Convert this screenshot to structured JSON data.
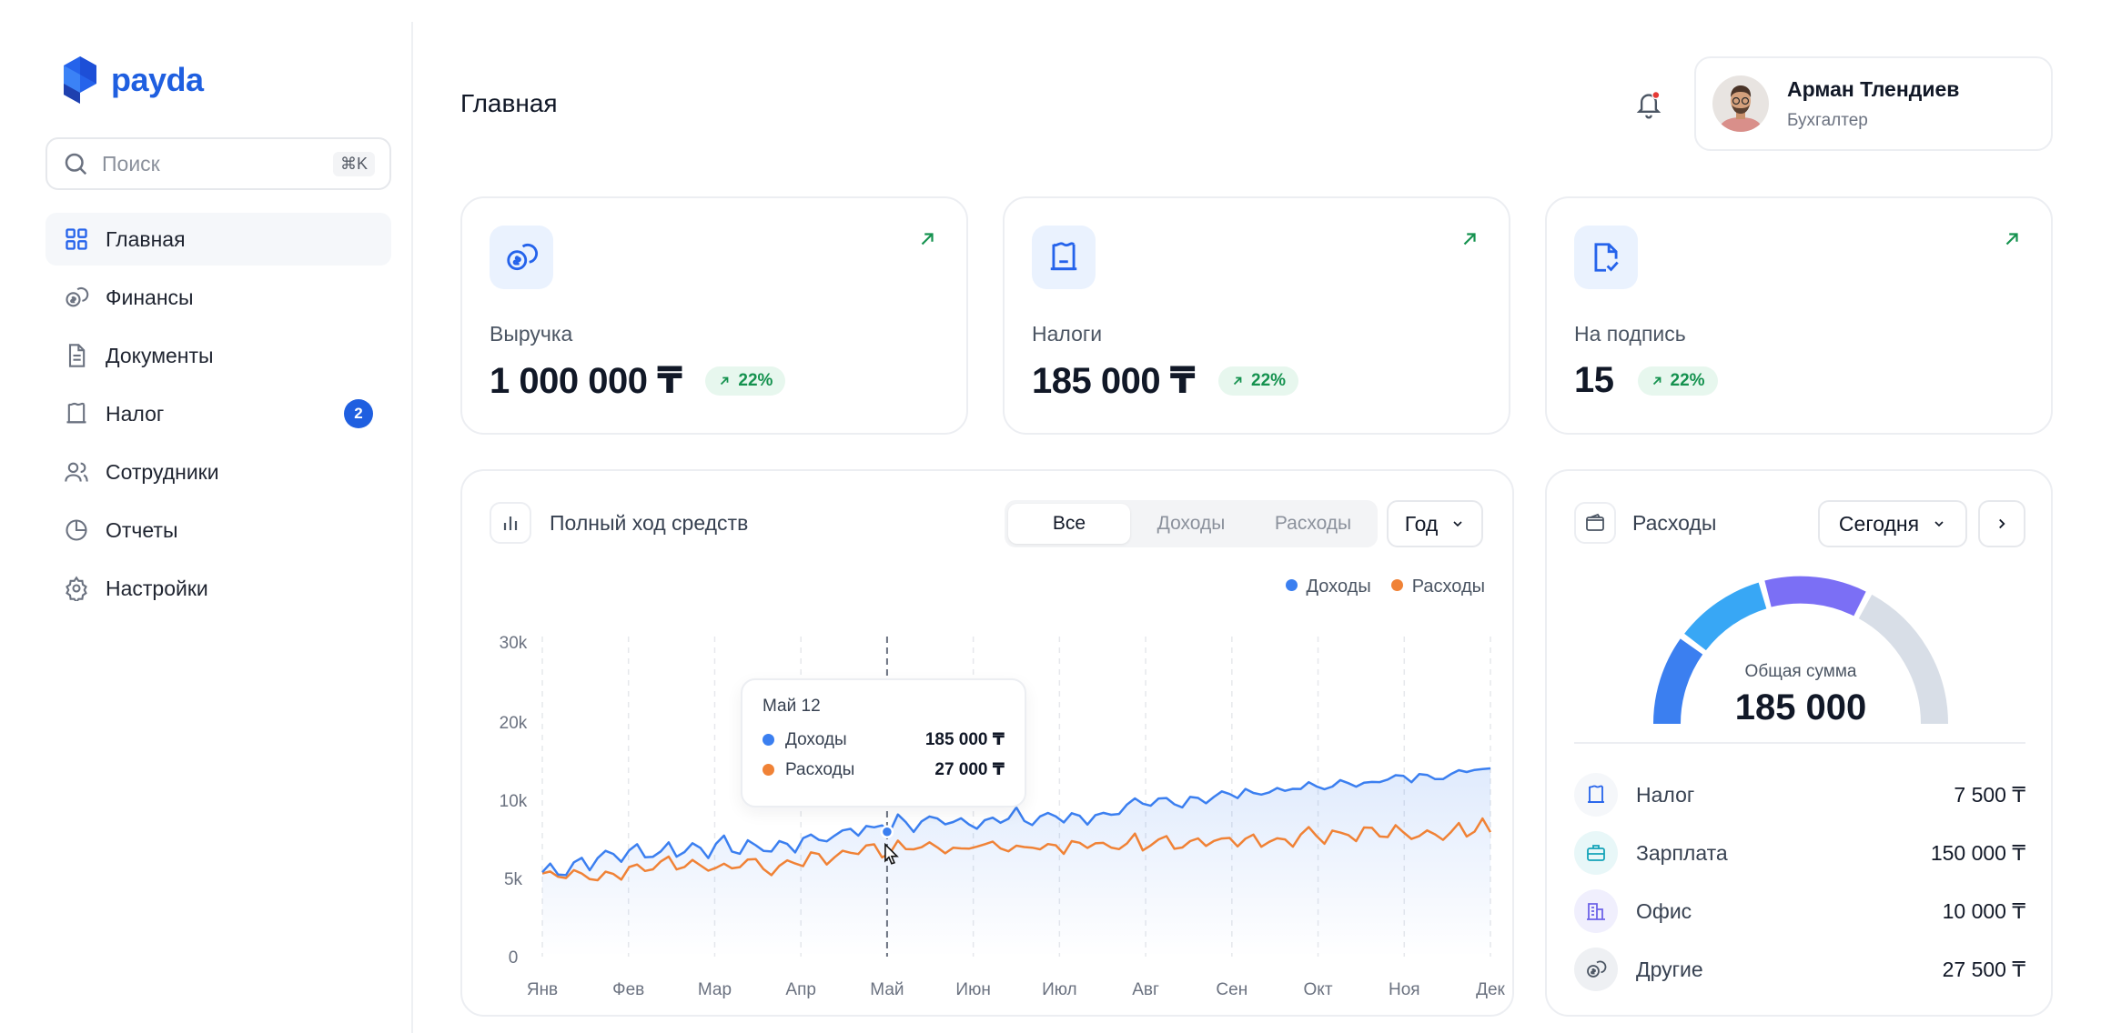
{
  "brand": {
    "name": "payda",
    "color": "#1f5fe0"
  },
  "search": {
    "placeholder": "Поиск",
    "shortcut": "⌘K"
  },
  "nav": [
    {
      "label": "Главная",
      "icon": "grid-icon",
      "active": true
    },
    {
      "label": "Финансы",
      "icon": "coins-icon"
    },
    {
      "label": "Документы",
      "icon": "document-icon"
    },
    {
      "label": "Налог",
      "icon": "receipt-icon",
      "badge": "2"
    },
    {
      "label": "Сотрудники",
      "icon": "users-icon"
    },
    {
      "label": "Отчеты",
      "icon": "pie-chart-icon"
    },
    {
      "label": "Настройки",
      "icon": "gear-icon"
    }
  ],
  "header": {
    "title": "Главная"
  },
  "user": {
    "name": "Арман Тлендиев",
    "role": "Бухгалтер"
  },
  "kpis": [
    {
      "label": "Выручка",
      "value": "1 000 000 ₸",
      "change": "22%",
      "icon": "coins-icon"
    },
    {
      "label": "Налоги",
      "value": "185 000 ₸",
      "change": "22%",
      "icon": "receipt-icon"
    },
    {
      "label": "На подпись",
      "value": "15",
      "change": "22%",
      "icon": "document-check-icon"
    }
  ],
  "cashflow": {
    "title": "Полный ход средств",
    "tabs": [
      "Все",
      "Доходы",
      "Расходы"
    ],
    "active_tab": "Все",
    "period": "Год",
    "tooltip": {
      "title": "Май 12",
      "rows": [
        {
          "name": "Доходы",
          "value": "185 000 ₸"
        },
        {
          "name": "Расходы",
          "value": "27 000 ₸"
        }
      ]
    }
  },
  "chart_data": {
    "type": "line",
    "categories": [
      "Янв",
      "Фев",
      "Мар",
      "Апр",
      "Май",
      "Июн",
      "Июл",
      "Авг",
      "Сен",
      "Окт",
      "Ноя",
      "Дек"
    ],
    "ylim": [
      0,
      30000
    ],
    "y_ticks": [
      "0",
      "5k",
      "10k",
      "20k",
      "30k"
    ],
    "grid": "vertical-dashed",
    "legend_position": "top-right",
    "series": [
      {
        "name": "Доходы",
        "color": "#3b7ff0",
        "values": [
          5400,
          6600,
          7000,
          7000,
          8200,
          8700,
          8800,
          9000,
          10000,
          11000,
          11900,
          12900,
          14000
        ]
      },
      {
        "name": "Расходы",
        "color": "#f08236",
        "values": [
          5000,
          5400,
          6000,
          5800,
          6800,
          6900,
          7000,
          7100,
          7300,
          7500,
          7700,
          7900,
          8200
        ]
      }
    ]
  },
  "expenses": {
    "title": "Расходы",
    "period": "Сегодня",
    "total_label": "Общая сумма",
    "total": "185 000",
    "gauge_colors": [
      "#3b7ff0",
      "#38a7f5",
      "#7b6ff5",
      "#d8dee7"
    ],
    "items": [
      {
        "name": "Налог",
        "value": "7 500 ₸",
        "icon": "receipt-icon"
      },
      {
        "name": "Зарплата",
        "value": "150 000 ₸",
        "icon": "briefcase-icon"
      },
      {
        "name": "Офис",
        "value": "10 000 ₸",
        "icon": "building-icon"
      },
      {
        "name": "Другие",
        "value": "27 500 ₸",
        "icon": "coins-icon"
      }
    ]
  }
}
